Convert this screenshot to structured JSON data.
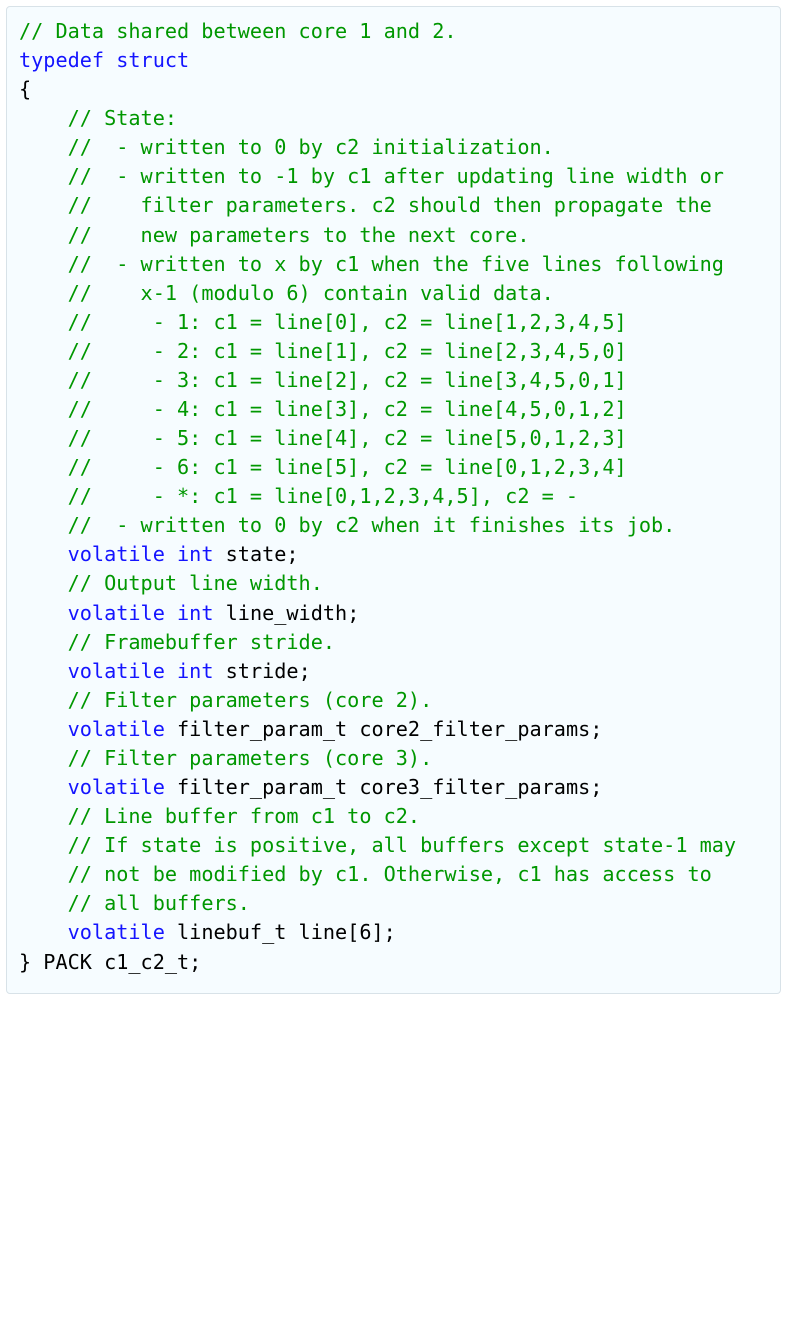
{
  "code": {
    "lines": [
      [
        {
          "cls": "c",
          "t": "// Data shared between core 1 and 2."
        }
      ],
      [
        {
          "cls": "k",
          "t": "typedef"
        },
        {
          "cls": "id",
          "t": " "
        },
        {
          "cls": "k",
          "t": "struct"
        }
      ],
      [
        {
          "cls": "p",
          "t": "{"
        }
      ],
      [
        {
          "cls": "id",
          "t": ""
        }
      ],
      [
        {
          "cls": "id",
          "t": "    "
        },
        {
          "cls": "c",
          "t": "// State:"
        }
      ],
      [
        {
          "cls": "id",
          "t": "    "
        },
        {
          "cls": "c",
          "t": "//  - written to 0 by c2 initialization."
        }
      ],
      [
        {
          "cls": "id",
          "t": "    "
        },
        {
          "cls": "c",
          "t": "//  - written to -1 by c1 after updating line width or"
        }
      ],
      [
        {
          "cls": "id",
          "t": "    "
        },
        {
          "cls": "c",
          "t": "//    filter parameters. c2 should then propagate the"
        }
      ],
      [
        {
          "cls": "id",
          "t": "    "
        },
        {
          "cls": "c",
          "t": "//    new parameters to the next core."
        }
      ],
      [
        {
          "cls": "id",
          "t": "    "
        },
        {
          "cls": "c",
          "t": "//  - written to x by c1 when the five lines following"
        }
      ],
      [
        {
          "cls": "id",
          "t": "    "
        },
        {
          "cls": "c",
          "t": "//    x-1 (modulo 6) contain valid data."
        }
      ],
      [
        {
          "cls": "id",
          "t": "    "
        },
        {
          "cls": "c",
          "t": "//     - 1: c1 = line[0], c2 = line[1,2,3,4,5]"
        }
      ],
      [
        {
          "cls": "id",
          "t": "    "
        },
        {
          "cls": "c",
          "t": "//     - 2: c1 = line[1], c2 = line[2,3,4,5,0]"
        }
      ],
      [
        {
          "cls": "id",
          "t": "    "
        },
        {
          "cls": "c",
          "t": "//     - 3: c1 = line[2], c2 = line[3,4,5,0,1]"
        }
      ],
      [
        {
          "cls": "id",
          "t": "    "
        },
        {
          "cls": "c",
          "t": "//     - 4: c1 = line[3], c2 = line[4,5,0,1,2]"
        }
      ],
      [
        {
          "cls": "id",
          "t": "    "
        },
        {
          "cls": "c",
          "t": "//     - 5: c1 = line[4], c2 = line[5,0,1,2,3]"
        }
      ],
      [
        {
          "cls": "id",
          "t": "    "
        },
        {
          "cls": "c",
          "t": "//     - 6: c1 = line[5], c2 = line[0,1,2,3,4]"
        }
      ],
      [
        {
          "cls": "id",
          "t": "    "
        },
        {
          "cls": "c",
          "t": "//     - *: c1 = line[0,1,2,3,4,5], c2 = -"
        }
      ],
      [
        {
          "cls": "id",
          "t": "    "
        },
        {
          "cls": "c",
          "t": "//  - written to 0 by c2 when it finishes its job."
        }
      ],
      [
        {
          "cls": "id",
          "t": "    "
        },
        {
          "cls": "k",
          "t": "volatile"
        },
        {
          "cls": "id",
          "t": " "
        },
        {
          "cls": "k",
          "t": "int"
        },
        {
          "cls": "id",
          "t": " state"
        },
        {
          "cls": "p",
          "t": ";"
        }
      ],
      [
        {
          "cls": "id",
          "t": ""
        }
      ],
      [
        {
          "cls": "id",
          "t": "    "
        },
        {
          "cls": "c",
          "t": "// Output line width."
        }
      ],
      [
        {
          "cls": "id",
          "t": "    "
        },
        {
          "cls": "k",
          "t": "volatile"
        },
        {
          "cls": "id",
          "t": " "
        },
        {
          "cls": "k",
          "t": "int"
        },
        {
          "cls": "id",
          "t": " line_width"
        },
        {
          "cls": "p",
          "t": ";"
        }
      ],
      [
        {
          "cls": "id",
          "t": ""
        }
      ],
      [
        {
          "cls": "id",
          "t": "    "
        },
        {
          "cls": "c",
          "t": "// Framebuffer stride."
        }
      ],
      [
        {
          "cls": "id",
          "t": "    "
        },
        {
          "cls": "k",
          "t": "volatile"
        },
        {
          "cls": "id",
          "t": " "
        },
        {
          "cls": "k",
          "t": "int"
        },
        {
          "cls": "id",
          "t": " stride"
        },
        {
          "cls": "p",
          "t": ";"
        }
      ],
      [
        {
          "cls": "id",
          "t": ""
        }
      ],
      [
        {
          "cls": "id",
          "t": "    "
        },
        {
          "cls": "c",
          "t": "// Filter parameters (core 2)."
        }
      ],
      [
        {
          "cls": "id",
          "t": "    "
        },
        {
          "cls": "k",
          "t": "volatile"
        },
        {
          "cls": "id",
          "t": " filter_param_t core2_filter_params"
        },
        {
          "cls": "p",
          "t": ";"
        }
      ],
      [
        {
          "cls": "id",
          "t": ""
        }
      ],
      [
        {
          "cls": "id",
          "t": "    "
        },
        {
          "cls": "c",
          "t": "// Filter parameters (core 3)."
        }
      ],
      [
        {
          "cls": "id",
          "t": "    "
        },
        {
          "cls": "k",
          "t": "volatile"
        },
        {
          "cls": "id",
          "t": " filter_param_t core3_filter_params"
        },
        {
          "cls": "p",
          "t": ";"
        }
      ],
      [
        {
          "cls": "id",
          "t": ""
        }
      ],
      [
        {
          "cls": "id",
          "t": "    "
        },
        {
          "cls": "c",
          "t": "// Line buffer from c1 to c2."
        }
      ],
      [
        {
          "cls": "id",
          "t": "    "
        },
        {
          "cls": "c",
          "t": "// If state is positive, all buffers except state-1 may"
        }
      ],
      [
        {
          "cls": "id",
          "t": "    "
        },
        {
          "cls": "c",
          "t": "// not be modified by c1. Otherwise, c1 has access to"
        }
      ],
      [
        {
          "cls": "id",
          "t": "    "
        },
        {
          "cls": "c",
          "t": "// all buffers."
        }
      ],
      [
        {
          "cls": "id",
          "t": "    "
        },
        {
          "cls": "k",
          "t": "volatile"
        },
        {
          "cls": "id",
          "t": " linebuf_t line"
        },
        {
          "cls": "p",
          "t": "["
        },
        {
          "cls": "id",
          "t": "6"
        },
        {
          "cls": "p",
          "t": "];"
        }
      ],
      [
        {
          "cls": "id",
          "t": ""
        }
      ],
      [
        {
          "cls": "p",
          "t": "}"
        },
        {
          "cls": "id",
          "t": " PACK c1_c2_t"
        },
        {
          "cls": "p",
          "t": ";"
        }
      ]
    ]
  }
}
